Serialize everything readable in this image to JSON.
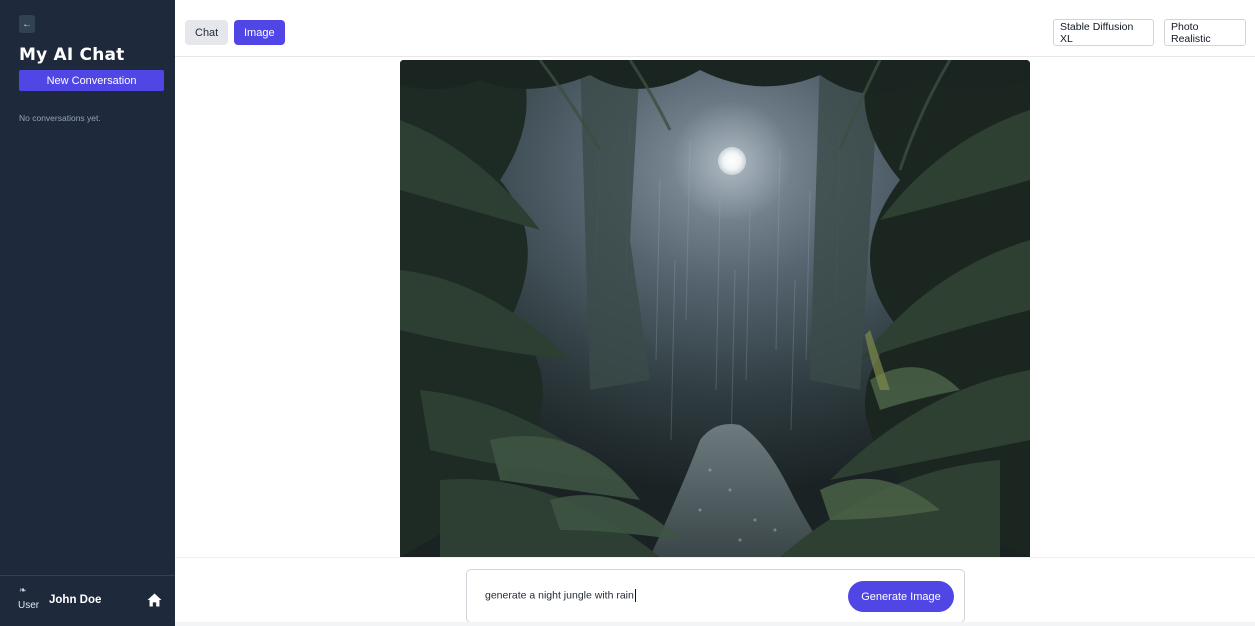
{
  "sidebar": {
    "collapse_icon": "arrow-left-icon",
    "title": "My AI Chat",
    "new_conversation_label": "New Conversation",
    "empty_text": "No conversations yet.",
    "user": {
      "avatar_alt": "User",
      "name": "John Doe",
      "home_icon": "home-icon"
    }
  },
  "header": {
    "tabs": [
      {
        "label": "Chat",
        "active": false
      },
      {
        "label": "Image",
        "active": true
      }
    ],
    "model_select": "Stable Diffusion XL",
    "style_select": "Photo Realistic"
  },
  "prompt": {
    "value": "generate a night jungle with rain",
    "button_label": "Generate Image"
  },
  "colors": {
    "accent": "#4f46e5",
    "sidebar_bg": "#1e293b"
  }
}
